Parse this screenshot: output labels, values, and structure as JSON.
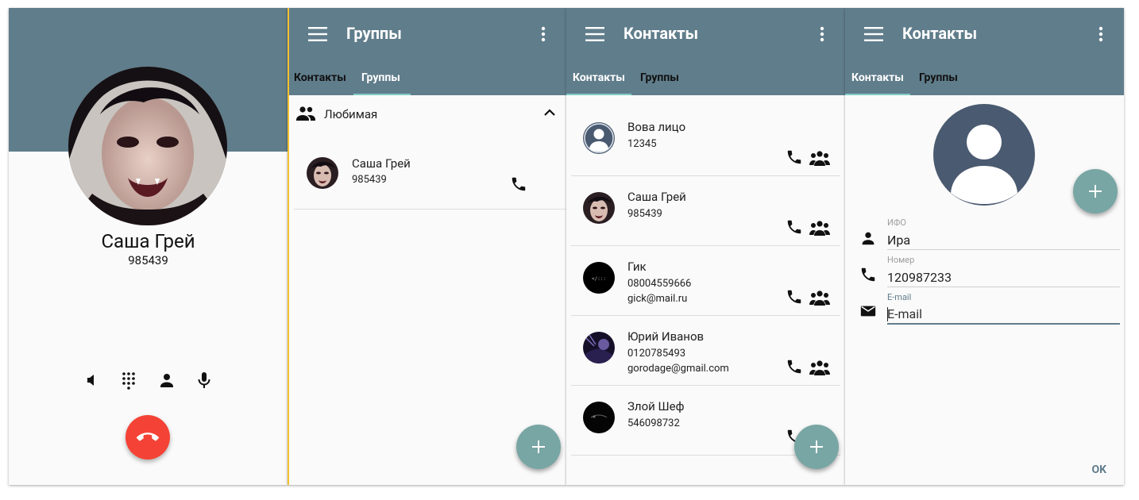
{
  "colors": {
    "primary": "#607d8b",
    "accent": "#78a6a4",
    "end_call": "#f44336",
    "indicator": "#80cbc4"
  },
  "call_screen": {
    "name": "Саша Грей",
    "number": "985439",
    "controls": [
      "speaker-icon",
      "dialpad-icon",
      "person-icon",
      "mic-icon"
    ]
  },
  "groups_screen": {
    "title": "Группы",
    "tabs": [
      {
        "label": "Контакты"
      },
      {
        "label": "Группы"
      }
    ],
    "group": {
      "title": "Любимая"
    },
    "contact": {
      "name": "Саша Грей",
      "phone": "985439"
    }
  },
  "contacts_screen": {
    "title": "Контакты",
    "tabs": [
      {
        "label": "Контакты"
      },
      {
        "label": "Группы"
      }
    ],
    "contacts": [
      {
        "name": "Вова лицо",
        "phone": "12345",
        "email": ""
      },
      {
        "name": "Саша Грей",
        "phone": "985439",
        "email": ""
      },
      {
        "name": "Гик",
        "phone": "08004559666",
        "email": "gick@mail.ru"
      },
      {
        "name": "Юрий Иванов",
        "phone": "0120785493",
        "email": "gorodage@gmail.com"
      },
      {
        "name": "Злой Шеф",
        "phone": "546098732",
        "email": ""
      }
    ]
  },
  "edit_screen": {
    "title": "Контакты",
    "tabs": [
      {
        "label": "Контакты"
      },
      {
        "label": "Группы"
      }
    ],
    "fields": {
      "name_label": "ИФО",
      "name_value": "Ира",
      "phone_label": "Номер",
      "phone_value": "120987233",
      "email_label": "E-mail",
      "email_placeholder": "E-mail"
    },
    "ok_label": "OK"
  }
}
